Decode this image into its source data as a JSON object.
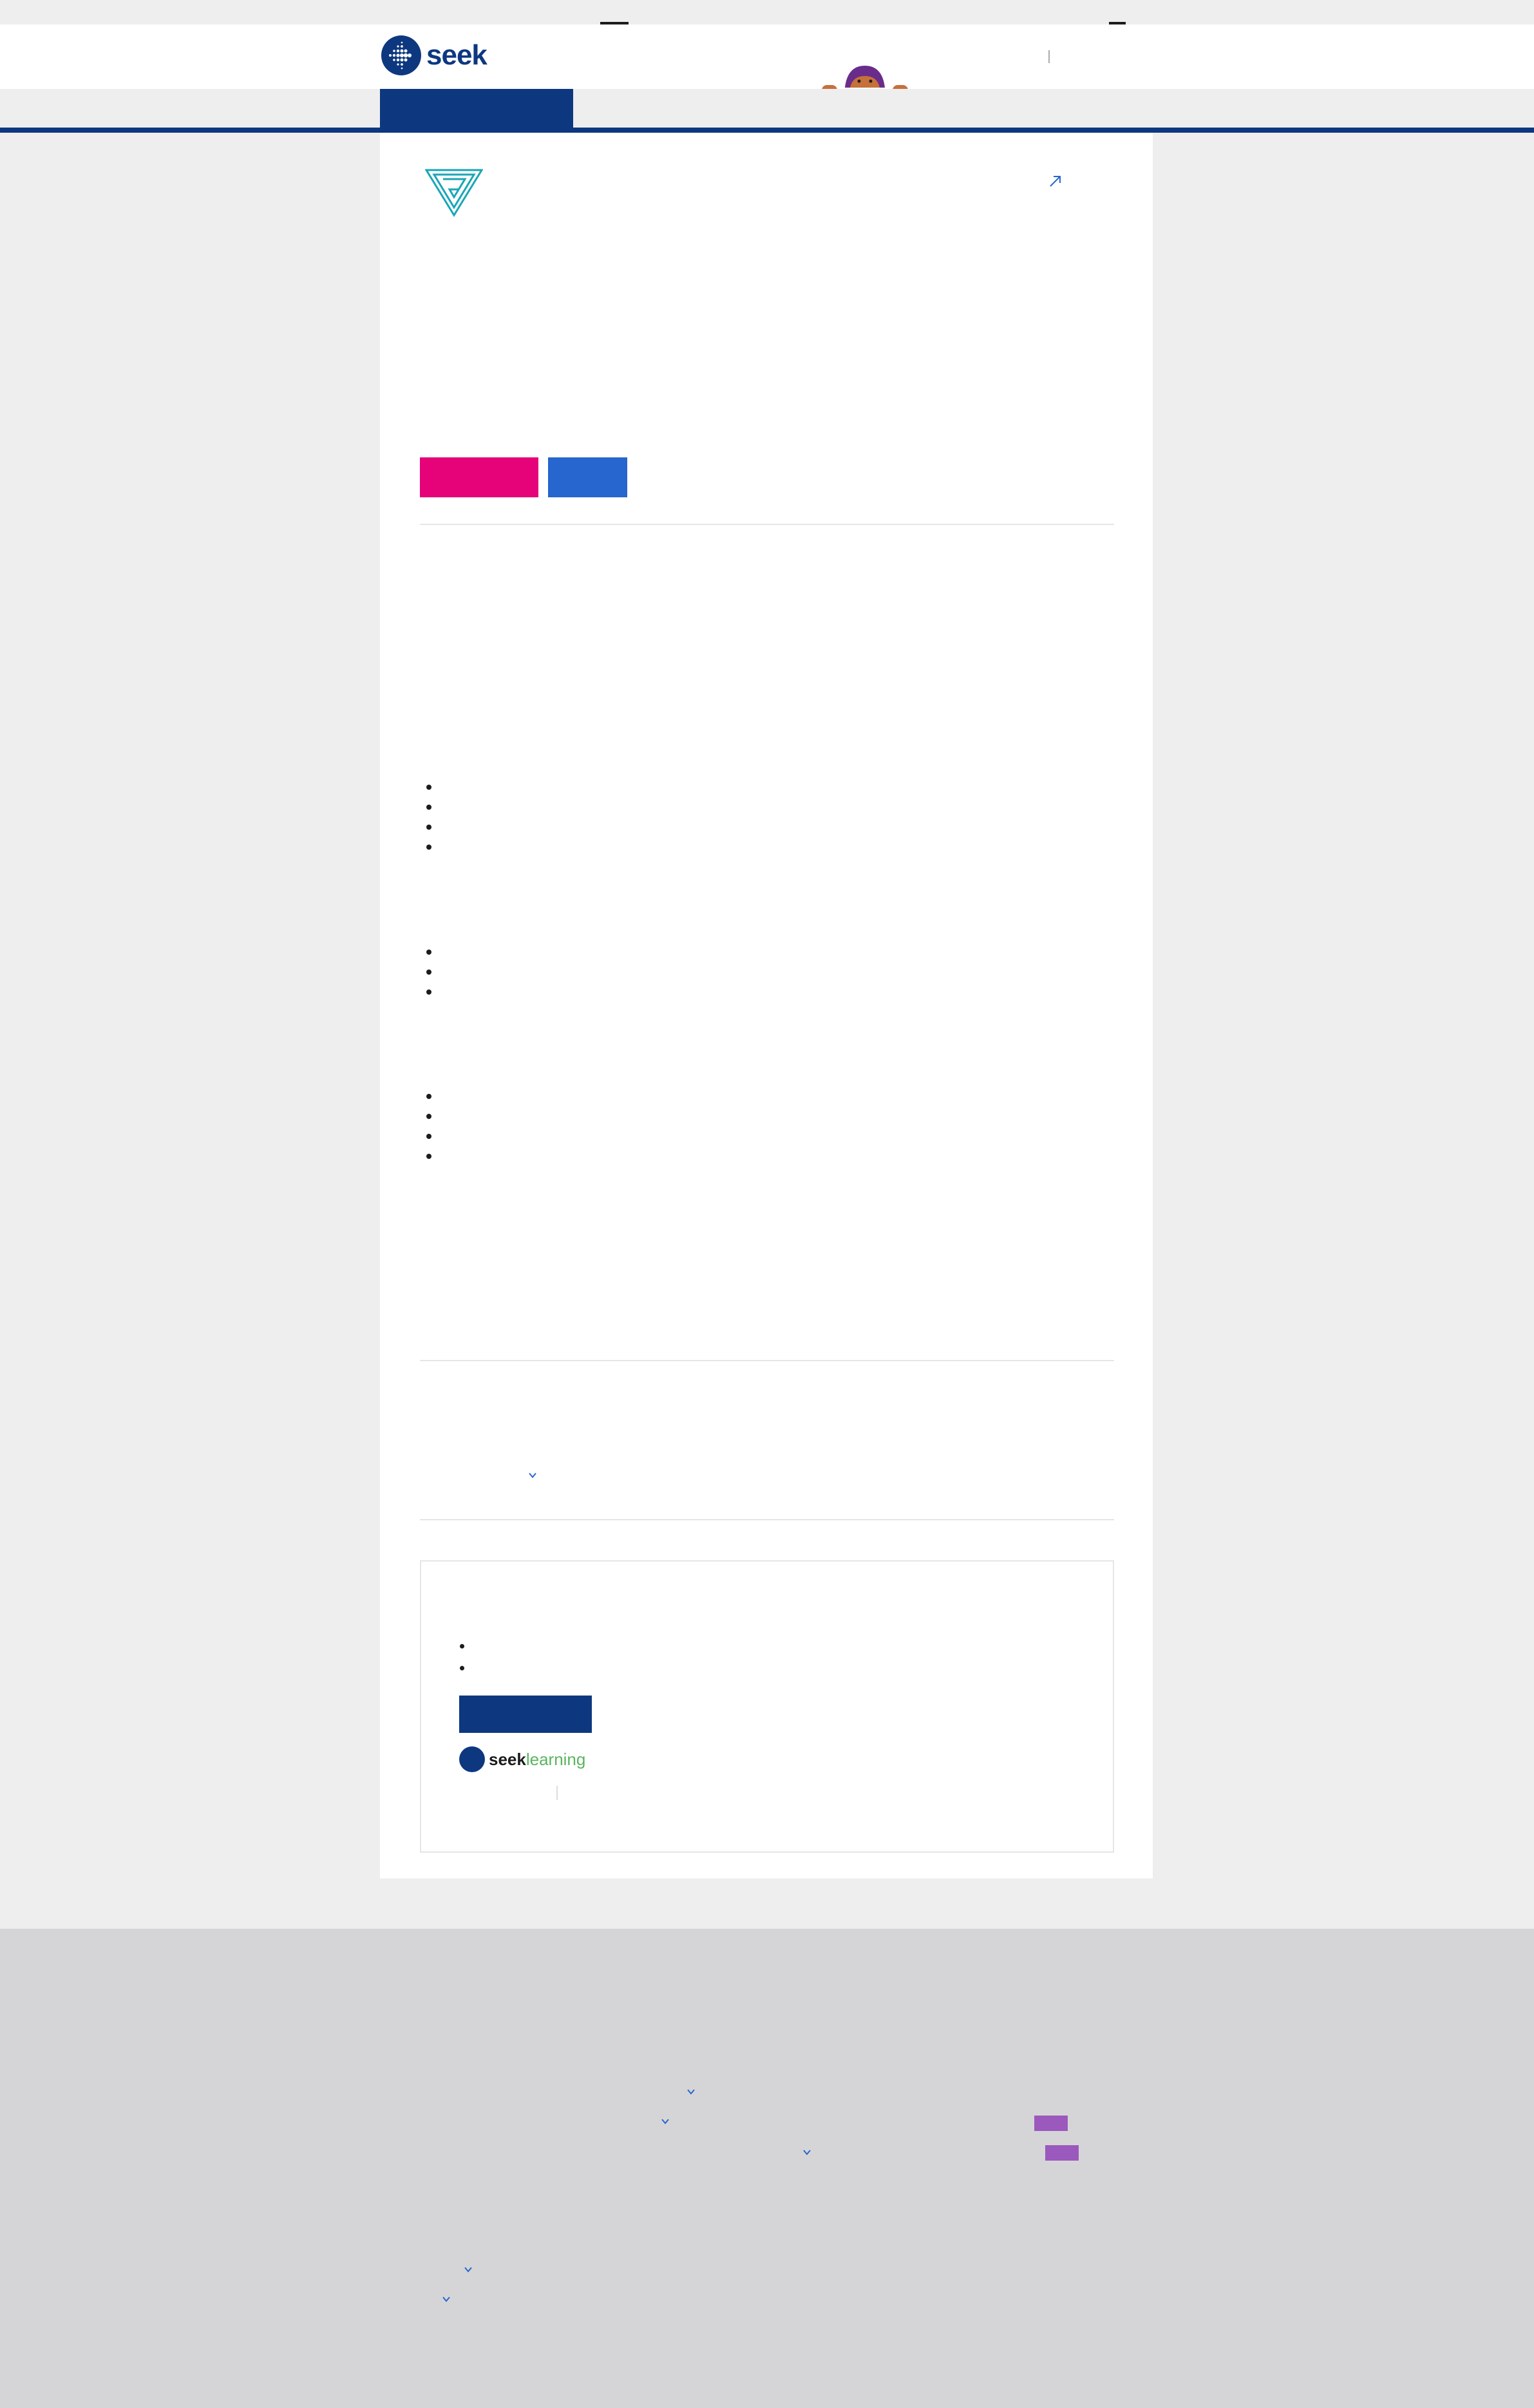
{
  "header": {
    "brand_name": "seek",
    "brand_color": "#0d3880",
    "logo_icon": "seek-dots-icon",
    "mascot_icon": "peeking-character-icon"
  },
  "job": {
    "company_logo_icon": "triangle-g-logo-icon",
    "share_icon": "share-icon",
    "apply_color": "#e60278",
    "save_color": "#2765cf"
  },
  "learning": {
    "brand_seek": "seek",
    "brand_learning": "learning",
    "brand_learning_color": "#5ab55e"
  },
  "colors": {
    "page_bg": "#eeeeee",
    "footer_bg": "#d5d5d7",
    "link_color": "#2765cf",
    "purple_badge": "#9b59bd"
  }
}
